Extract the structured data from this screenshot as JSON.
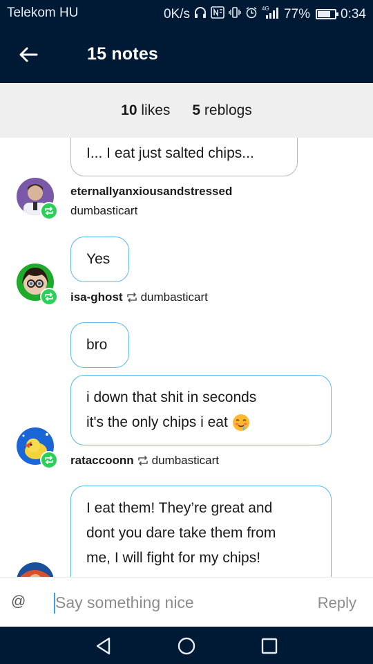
{
  "status_bar": {
    "carrier": "Telekom HU",
    "speed": "0K/s",
    "network": "4G",
    "battery_percent": "77%",
    "battery_level": 0.77,
    "time": "0:34"
  },
  "header": {
    "title": "15 notes"
  },
  "tabs": {
    "likes_count": "10",
    "likes_label": "likes",
    "reblogs_count": "5",
    "reblogs_label": "reblogs"
  },
  "notes": [
    {
      "user": "eternallyanxiousandstressed",
      "source": "dumbasticart",
      "bubbles": [
        "I... I eat just salted chips..."
      ]
    },
    {
      "user": "isa-ghost",
      "source": "dumbasticart",
      "bubbles": [
        "Yes"
      ]
    },
    {
      "user": "rataccoonn",
      "source": "dumbasticart",
      "bubbles": [
        "bro",
        "i down that shit in seconds",
        "it's the only chips i eat"
      ]
    },
    {
      "user": "",
      "source": "",
      "bubbles": [
        "I eat them! They’re great and",
        "dont you dare take them from",
        "me, I will fight for my chips!"
      ]
    }
  ],
  "reply": {
    "at_symbol": "@",
    "placeholder": "Say something nice",
    "button": "Reply"
  },
  "colors": {
    "navy": "#001935",
    "bubble_border": "#5ab8e8",
    "reblog_green": "#2ad158"
  }
}
